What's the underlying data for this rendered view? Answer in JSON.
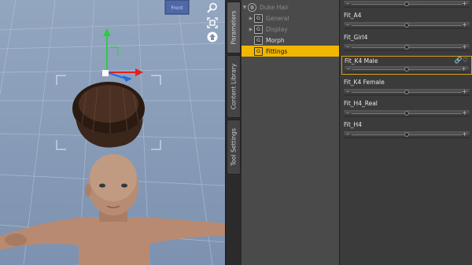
{
  "viewport": {
    "camera_cube_label": "Front",
    "tools": [
      {
        "icon": "magnifier-icon"
      },
      {
        "icon": "frame-icon"
      },
      {
        "icon": "home-icon"
      }
    ]
  },
  "side_tabs": [
    {
      "label": "Parameters",
      "active": true
    },
    {
      "label": "Content Library",
      "active": false
    },
    {
      "label": "Tool Settings",
      "active": false
    }
  ],
  "tree": {
    "root": {
      "label": "Duke Hair"
    },
    "items": [
      {
        "label": "General",
        "expandable": true,
        "dim": true,
        "selected": false
      },
      {
        "label": "Display",
        "expandable": true,
        "dim": true,
        "selected": false
      },
      {
        "label": "Morph",
        "expandable": false,
        "dim": false,
        "selected": false
      },
      {
        "label": "Fittings",
        "expandable": false,
        "dim": false,
        "selected": true
      }
    ],
    "group_glyph": "G"
  },
  "parameters": {
    "slider_minus": "–",
    "slider_plus": "+",
    "items": [
      {
        "name": "",
        "value": 0.5,
        "highlighted": false
      },
      {
        "name": "Fit_A4",
        "value": 0.5,
        "highlighted": false
      },
      {
        "name": "Fit_Girl4",
        "value": 0.5,
        "highlighted": false
      },
      {
        "name": "Fit_K4 Male",
        "value": 0.5,
        "highlighted": true,
        "icons": "🔗♡"
      },
      {
        "name": "Fit_K4 Female",
        "value": 0.5,
        "highlighted": false
      },
      {
        "name": "Fit_H4_Real",
        "value": 0.5,
        "highlighted": false
      },
      {
        "name": "Fit_H4",
        "value": 0.5,
        "highlighted": false
      }
    ]
  },
  "colors": {
    "selection": "#f2b600",
    "highlight_border": "#d4a017",
    "viewport_bg": "#8b9fba"
  }
}
